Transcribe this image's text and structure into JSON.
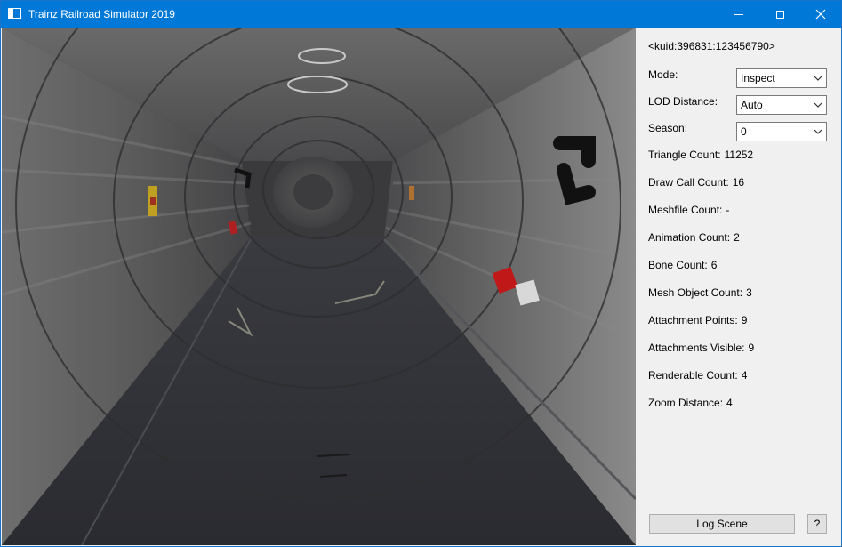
{
  "window": {
    "title": "Trainz Railroad Simulator 2019"
  },
  "panel": {
    "kuid": "<kuid:396831:123456790>",
    "mode": {
      "label": "Mode:",
      "value": "Inspect"
    },
    "lod": {
      "label": "LOD Distance:",
      "value": "Auto"
    },
    "season": {
      "label": "Season:",
      "value": "0"
    },
    "stats": [
      {
        "label": "Triangle Count:",
        "value": "11252"
      },
      {
        "label": "Draw Call Count:",
        "value": "16"
      },
      {
        "label": "Meshfile Count:",
        "value": "-"
      },
      {
        "label": "Animation Count:",
        "value": "2"
      },
      {
        "label": "Bone Count:",
        "value": "6"
      },
      {
        "label": "Mesh Object Count:",
        "value": "3"
      },
      {
        "label": "Attachment Points:",
        "value": "9"
      },
      {
        "label": "Attachments Visible:",
        "value": "9"
      },
      {
        "label": "Renderable Count:",
        "value": "4"
      },
      {
        "label": "Zoom Distance:",
        "value": "4"
      }
    ],
    "log_button": "Log Scene",
    "help_button": "?"
  },
  "icons": {
    "app": "app-window-icon",
    "minimize": "minimize-icon",
    "maximize": "maximize-icon",
    "close": "close-icon",
    "dropdown": "chevron-down-icon"
  },
  "colors": {
    "titlebar": "#0078d7",
    "panel": "#f0f0f0",
    "viewport_bg": "#3a3a3c"
  }
}
